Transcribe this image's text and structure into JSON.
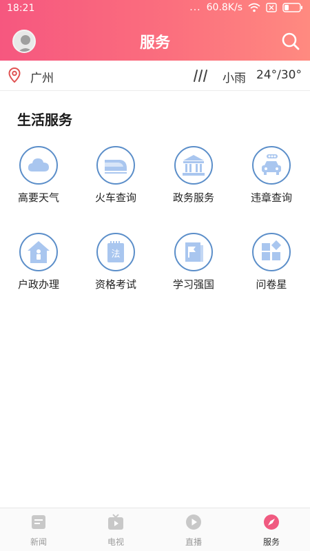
{
  "status_bar": {
    "time": "18:21",
    "dots": "...",
    "speed": "60.8K/s"
  },
  "header": {
    "title": "服务"
  },
  "weather": {
    "city": "广州",
    "condition": "小雨",
    "temperature": "24°/30°"
  },
  "section": {
    "title": "生活服务",
    "items": [
      {
        "label": "高要天气",
        "icon": "cloud-icon"
      },
      {
        "label": "火车查询",
        "icon": "train-icon"
      },
      {
        "label": "政务服务",
        "icon": "government-building-icon"
      },
      {
        "label": "违章查询",
        "icon": "car-traffic-light-icon"
      },
      {
        "label": "户政办理",
        "icon": "house-person-icon"
      },
      {
        "label": "资格考试",
        "icon": "law-book-icon",
        "icon_text": "法"
      },
      {
        "label": "学习强国",
        "icon": "flag-book-icon"
      },
      {
        "label": "问卷星",
        "icon": "squares-icon"
      }
    ]
  },
  "tabbar": {
    "items": [
      {
        "label": "新闻",
        "icon": "news-icon",
        "active": false
      },
      {
        "label": "电视",
        "icon": "tv-icon",
        "active": false
      },
      {
        "label": "直播",
        "icon": "play-icon",
        "active": false
      },
      {
        "label": "服务",
        "icon": "compass-icon",
        "active": true
      }
    ]
  },
  "colors": {
    "header_start": "#f6577f",
    "header_end": "#ff8a80",
    "icon_blue": "#5b8ec9",
    "active_tab": "#f05a80"
  }
}
